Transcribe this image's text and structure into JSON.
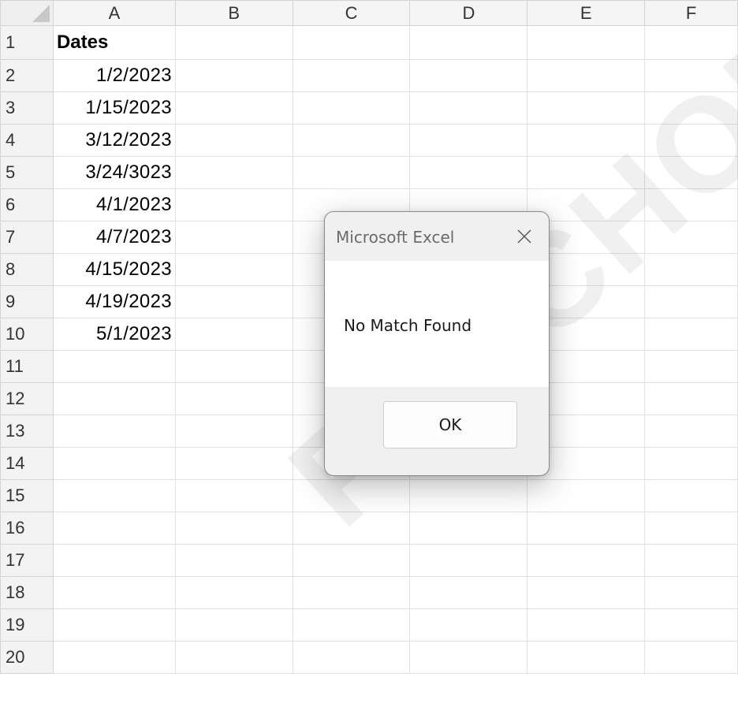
{
  "columns": [
    "A",
    "B",
    "C",
    "D",
    "E",
    "F"
  ],
  "rows": [
    {
      "num": "1",
      "a": "Dates"
    },
    {
      "num": "2",
      "a": "1/2/2023"
    },
    {
      "num": "3",
      "a": "1/15/2023"
    },
    {
      "num": "4",
      "a": "3/12/2023"
    },
    {
      "num": "5",
      "a": "3/24/3023"
    },
    {
      "num": "6",
      "a": "4/1/2023"
    },
    {
      "num": "7",
      "a": "4/7/2023"
    },
    {
      "num": "8",
      "a": "4/15/2023"
    },
    {
      "num": "9",
      "a": "4/19/2023"
    },
    {
      "num": "10",
      "a": "5/1/2023"
    },
    {
      "num": "11",
      "a": ""
    },
    {
      "num": "12",
      "a": ""
    },
    {
      "num": "13",
      "a": ""
    },
    {
      "num": "14",
      "a": ""
    },
    {
      "num": "15",
      "a": ""
    },
    {
      "num": "16",
      "a": ""
    },
    {
      "num": "17",
      "a": ""
    },
    {
      "num": "18",
      "a": ""
    },
    {
      "num": "19",
      "a": ""
    },
    {
      "num": "20",
      "a": ""
    }
  ],
  "dialog": {
    "title": "Microsoft Excel",
    "message": "No Match Found",
    "ok_label": "OK",
    "close_icon": "close-icon"
  },
  "watermark": {
    "text": "PSYCHOLOGY"
  }
}
